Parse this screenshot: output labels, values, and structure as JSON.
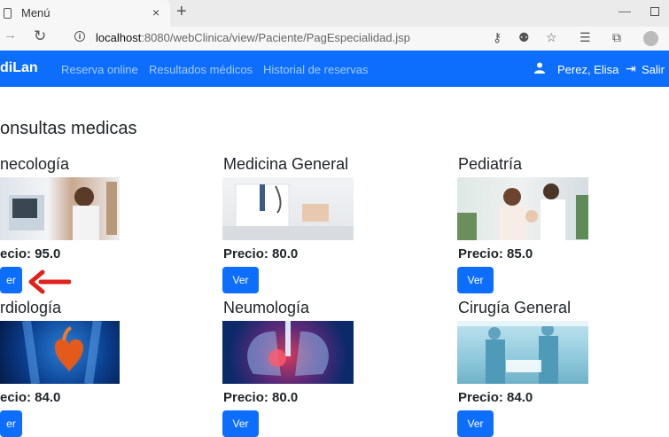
{
  "browser": {
    "tab_title": "Menú",
    "tab_close": "×",
    "new_tab": "+",
    "url_host": "localhost",
    "url_rest": ":8080/webClinica/view/Paciente/PagEspecialidad.jsp"
  },
  "navbar": {
    "brand": "diLan",
    "links": [
      "Reserva online",
      "Resultados médicos",
      "Historial de reservas"
    ],
    "user": "Perez, Elisa",
    "logout": "Salir"
  },
  "page_title": "onsultas medicas",
  "cards": [
    {
      "title": "necología",
      "price": "ecio: 95.0",
      "button": "er"
    },
    {
      "title": "Medicina General",
      "price": "Precio: 80.0",
      "button": "Ver"
    },
    {
      "title": "Pediatría",
      "price": "Precio: 85.0",
      "button": "Ver"
    },
    {
      "title": "rdiología",
      "price": "ecio: 84.0",
      "button": "er"
    },
    {
      "title": "Neumología",
      "price": "Precio: 80.0",
      "button": "Ver"
    },
    {
      "title": "Cirugía General",
      "price": "Precio: 84.0",
      "button": "Ver"
    }
  ],
  "colors": {
    "primary": "#0d6efd",
    "annotation_arrow": "#e0201b"
  },
  "icons": [
    "back-icon",
    "reload-icon",
    "info-icon",
    "key-icon",
    "profile-icon",
    "favorite-icon",
    "favorites-bar-icon",
    "collections-icon",
    "user-icon",
    "logout-icon"
  ]
}
